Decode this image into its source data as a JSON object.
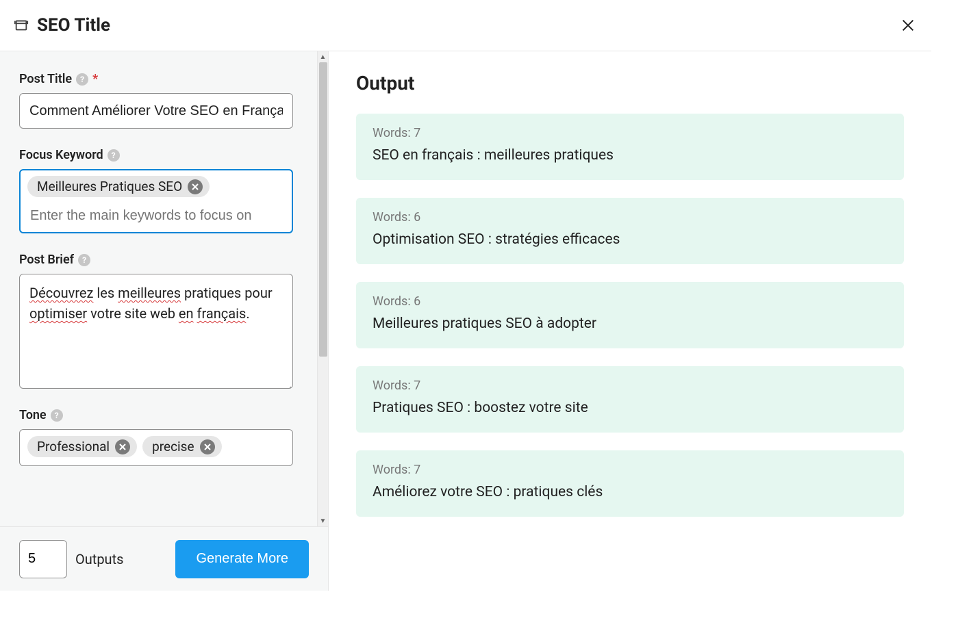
{
  "header": {
    "title": "SEO Title"
  },
  "form": {
    "post_title": {
      "label": "Post Title",
      "required": true,
      "value": "Comment Améliorer Votre SEO en Français"
    },
    "focus_keyword": {
      "label": "Focus Keyword",
      "tags": [
        "Meilleures Pratiques SEO"
      ],
      "placeholder": "Enter the main keywords to focus on"
    },
    "post_brief": {
      "label": "Post Brief",
      "value": "Découvrez les meilleures pratiques pour optimiser votre site web en français."
    },
    "tone": {
      "label": "Tone",
      "tags": [
        "Professional",
        "precise"
      ]
    }
  },
  "footer": {
    "outputs_count": "5",
    "outputs_label": "Outputs",
    "generate_button": "Generate More"
  },
  "output": {
    "heading": "Output",
    "words_prefix": "Words: ",
    "items": [
      {
        "words": 7,
        "text": "SEO en français : meilleures pratiques"
      },
      {
        "words": 6,
        "text": "Optimisation SEO : stratégies efficaces"
      },
      {
        "words": 6,
        "text": "Meilleures pratiques SEO à adopter"
      },
      {
        "words": 7,
        "text": "Pratiques SEO : boostez votre site"
      },
      {
        "words": 7,
        "text": "Améliorez votre SEO : pratiques clés"
      }
    ]
  }
}
